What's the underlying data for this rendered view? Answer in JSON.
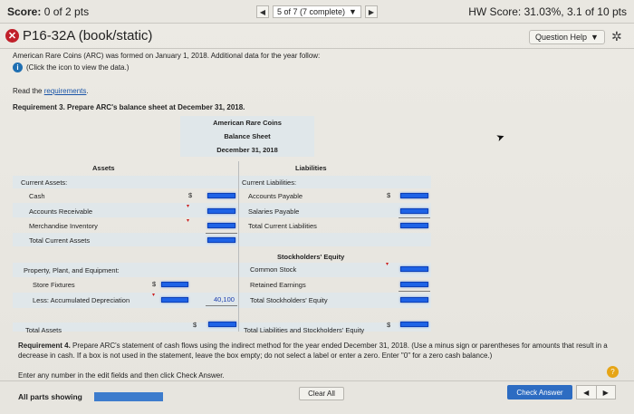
{
  "header": {
    "score_label": "Score:",
    "score_value": "0 of 2 pts",
    "nav_position": "5 of 7 (7 complete)",
    "hw_score": "HW Score: 31.03%, 3.1 of 10 pts"
  },
  "problem": {
    "title": "P16-32A (book/static)",
    "question_help": "Question Help",
    "intro": "American Rare Coins (ARC) was formed on January 1, 2018. Additional data for the year follow:",
    "data_hint": "(Click the icon to view the data.)",
    "read_prefix": "Read the ",
    "read_link": "requirements",
    "read_suffix": ".",
    "requirement3": "Requirement 3. Prepare ARC's balance sheet at December 31, 2018."
  },
  "sheet": {
    "company": "American Rare Coins",
    "statement": "Balance Sheet",
    "date": "December 31, 2018",
    "assets_header": "Assets",
    "liabilities_header": "Liabilities",
    "current_assets": "Current Assets:",
    "cash": "Cash",
    "accounts_receivable": "Accounts Receivable",
    "merchandise_inventory": "Merchandise Inventory",
    "total_current_assets": "Total Current Assets",
    "ppe": "Property, Plant, and Equipment:",
    "store_fixtures": "Store Fixtures",
    "less_depreciation": "Less: Accumulated Depreciation",
    "total_assets": "Total Assets",
    "current_liabilities": "Current Liabilities:",
    "accounts_payable": "Accounts Payable",
    "salaries_payable": "Salaries Payable",
    "total_current_liabilities": "Total Current Liabilities",
    "se_header": "Stockholders' Equity",
    "common_stock": "Common Stock",
    "retained_earnings": "Retained Earnings",
    "total_se": "Total Stockholders' Equity",
    "total_liab_se": "Total Liabilities and Stockholders' Equity",
    "dollar": "$",
    "depreciation_value": "40,100"
  },
  "requirement4": {
    "line1_bold": "Requirement 4.",
    "line1": " Prepare ARC's statement of cash flows using the indirect method for the year ended December 31, 2018. (Use a minus sign or parentheses for amounts that result in a",
    "line2": "decrease in cash. If a box is not used in the statement, leave the box empty; do not select a label or enter a zero. Enter \"0\" for a zero cash balance.)"
  },
  "footer": {
    "instruction": "Enter any number in the edit fields and then click Check Answer.",
    "all_parts": "All parts showing",
    "clear_all": "Clear All",
    "check_answer": "Check Answer"
  },
  "colors": {
    "accent": "#2d6cc2",
    "error": "#c0202a",
    "field_highlight": "#1e63e6",
    "table_shade": "#e0e7ea"
  }
}
